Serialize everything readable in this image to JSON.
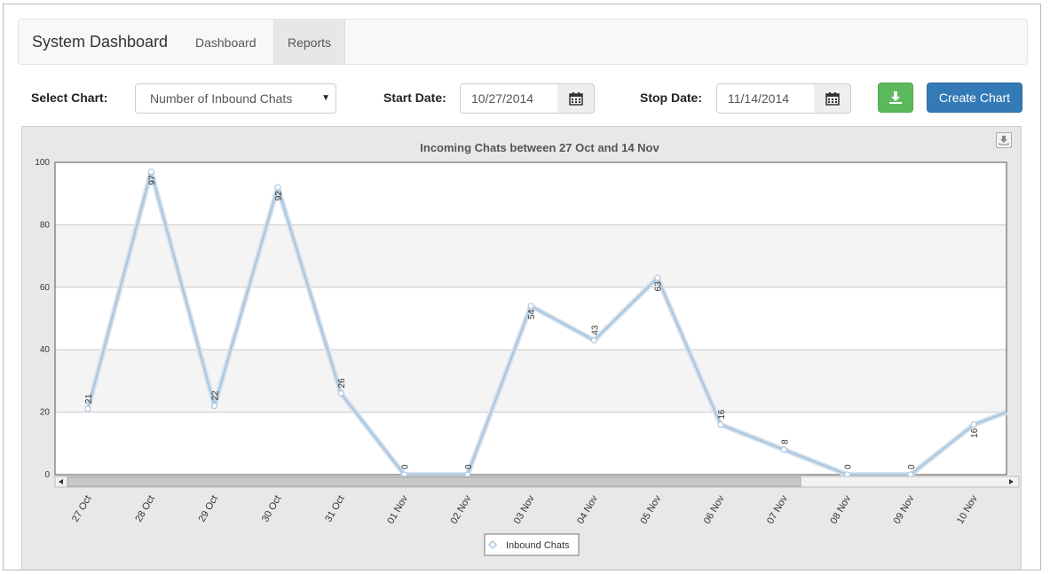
{
  "navbar": {
    "brand": "System Dashboard",
    "items": [
      {
        "label": "Dashboard",
        "active": false
      },
      {
        "label": "Reports",
        "active": true
      }
    ]
  },
  "controls": {
    "select_chart_label": "Select Chart:",
    "selected_chart": "Number of Inbound Chats",
    "start_date_label": "Start Date:",
    "start_date": "10/27/2014",
    "stop_date_label": "Stop Date:",
    "stop_date": "11/14/2014",
    "download_icon": "download-icon",
    "create_chart_label": "Create Chart"
  },
  "colors": {
    "accent_blue": "#337ab7",
    "success_green": "#5cb85c",
    "series_line": "#b7d0e4"
  },
  "chart_data": {
    "type": "line",
    "title": "Incoming Chats between 27 Oct and 14 Nov",
    "categories": [
      "27 Oct",
      "28 Oct",
      "29 Oct",
      "30 Oct",
      "31 Oct",
      "01 Nov",
      "02 Nov",
      "03 Nov",
      "04 Nov",
      "05 Nov",
      "06 Nov",
      "07 Nov",
      "08 Nov",
      "09 Nov",
      "10 Nov"
    ],
    "series": [
      {
        "name": "Inbound Chats",
        "values": [
          21,
          97,
          22,
          92,
          26,
          0,
          0,
          54,
          43,
          63,
          16,
          8,
          0,
          0,
          16
        ]
      }
    ],
    "trailing_value": 20,
    "yticks": [
      0,
      20,
      40,
      60,
      80,
      100
    ],
    "ylim": [
      0,
      100
    ],
    "grid": true,
    "legend": "bottom-center",
    "scrollbar": true
  }
}
